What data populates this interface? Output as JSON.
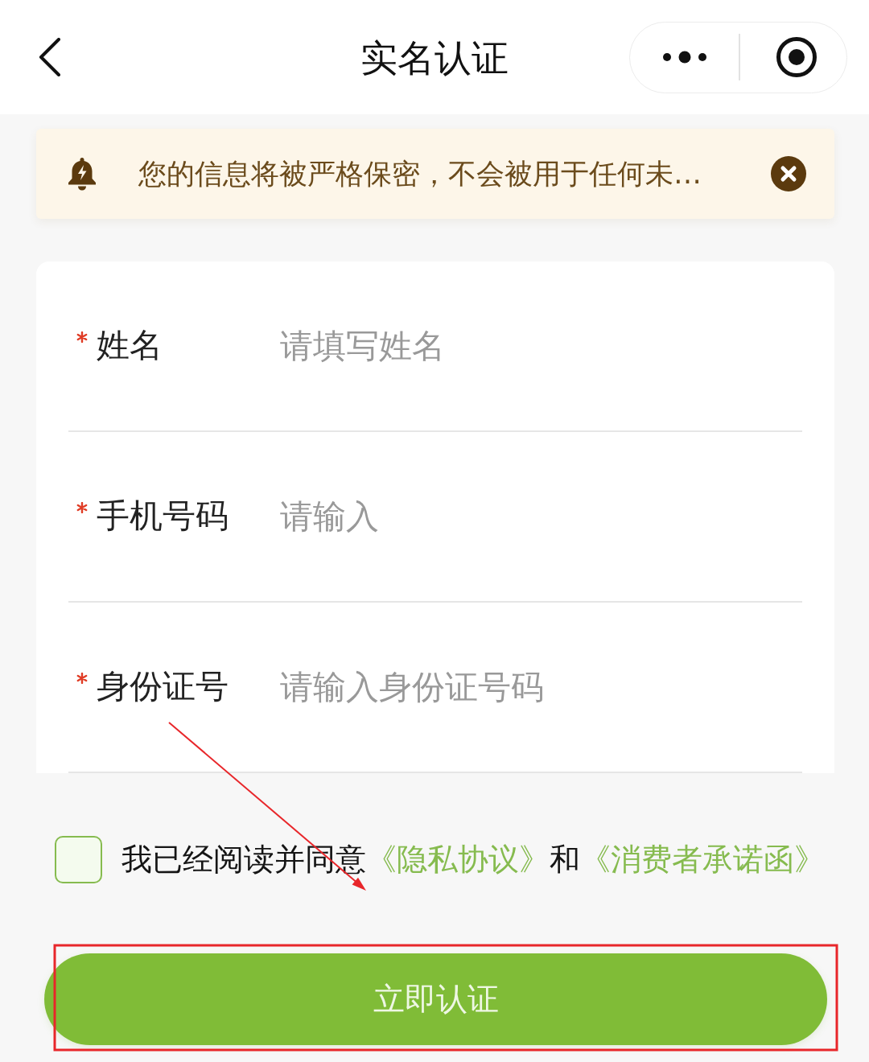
{
  "nav_bar": {
    "title": "实名认证"
  },
  "notice": {
    "text": "您的信息将被严格保密，不会被用于任何未…"
  },
  "form": {
    "fields": [
      {
        "label": "姓名",
        "required": true,
        "placeholder": "请填写姓名"
      },
      {
        "label": "手机号码",
        "required": true,
        "placeholder": "请输入"
      },
      {
        "label": "身份证号",
        "required": true,
        "placeholder": "请输入身份证号码"
      }
    ]
  },
  "agreement": {
    "checked": false,
    "parts": [
      {
        "kind": "text",
        "text": "我已经阅读并同意"
      },
      {
        "kind": "link",
        "text": "《隐私协议》"
      },
      {
        "kind": "text",
        "text": "和"
      },
      {
        "kind": "link",
        "text": "《消费者承诺函》"
      }
    ]
  },
  "submit_button": {
    "label": "立即认证"
  },
  "annotation": {
    "arrow": true,
    "highlight_frame": true
  }
}
